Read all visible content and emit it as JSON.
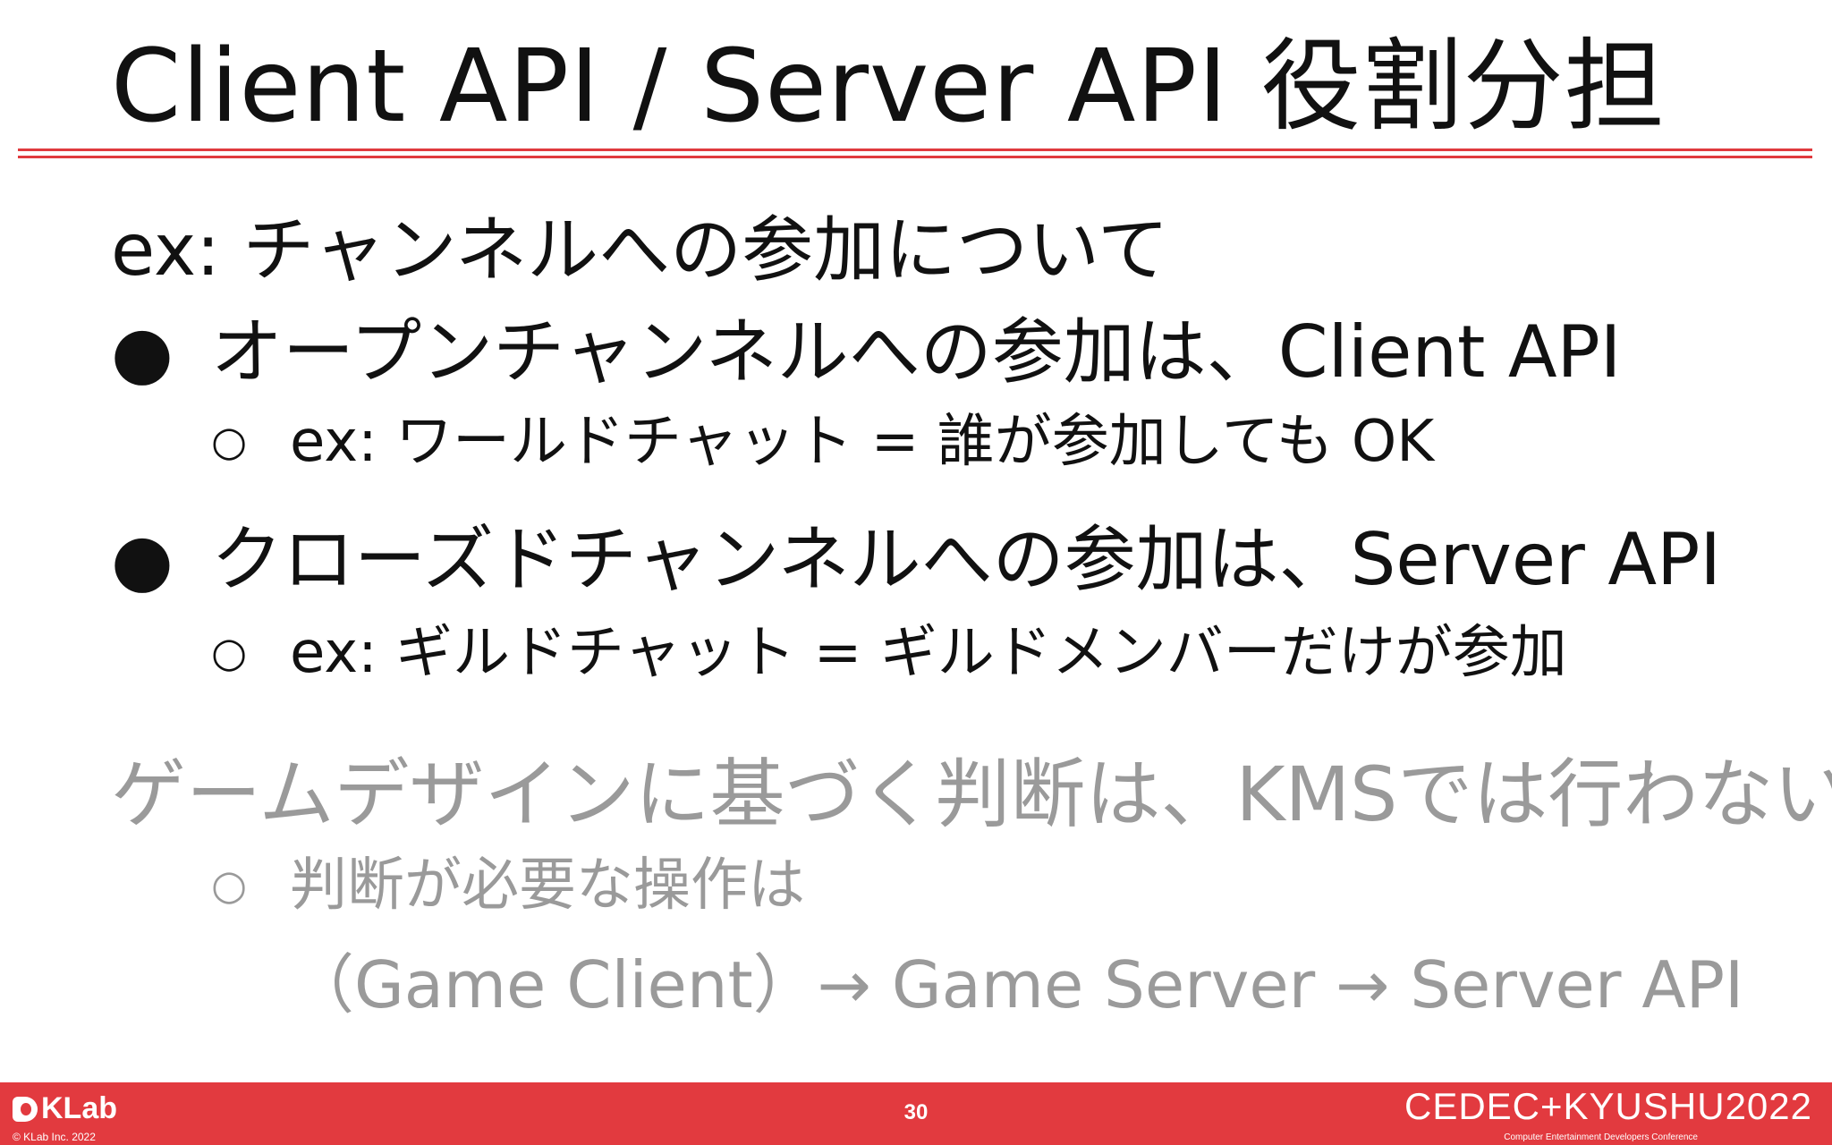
{
  "slide": {
    "title": "Client API / Server API 役割分担",
    "lead": "ex: チャンネルへの参加について",
    "bullet_symbol": "●",
    "sub_bullet_symbol": "○",
    "items": [
      {
        "text": "オープンチャンネルへの参加は、Client API",
        "sub": "ex: ワールドチャット = 誰が参加しても OK"
      },
      {
        "text": "クローズドチャンネルへの参加は、Server API",
        "sub": "ex: ギルドチャット = ギルドメンバーだけが参加"
      }
    ],
    "note": {
      "text": "ゲームデザインに基づく判断は、KMSでは行わない",
      "sub_line1": "判断が必要な操作は",
      "sub_line2": "（Game Client）→ Game Server → Server API"
    }
  },
  "footer": {
    "company_logo_text": "KLab",
    "copyright": "© KLab Inc. 2022",
    "page_number": "30",
    "event_logo_text": "CEDEC+KYUSHU2022",
    "event_subtitle": "Computer Entertainment Developers Conference"
  },
  "colors": {
    "accent": "#e23a3f",
    "text": "#111111",
    "muted_text": "#9a9a9a",
    "background": "#ffffff"
  }
}
